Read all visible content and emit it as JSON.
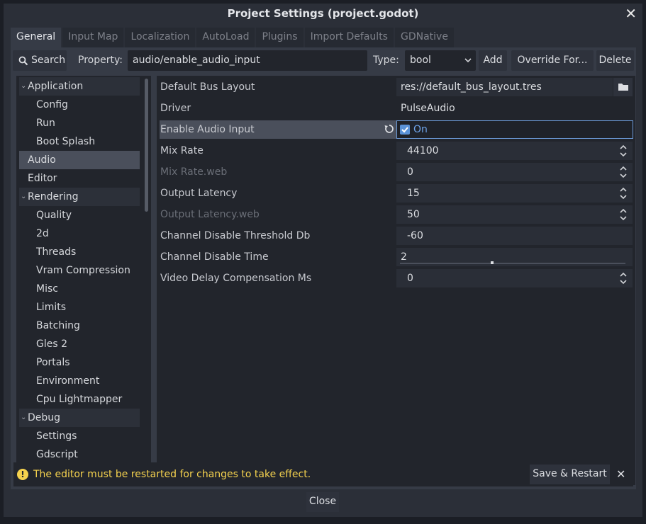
{
  "window": {
    "title": "Project Settings (project.godot)"
  },
  "tabs": [
    {
      "label": "General",
      "active": true
    },
    {
      "label": "Input Map",
      "active": false
    },
    {
      "label": "Localization",
      "active": false
    },
    {
      "label": "AutoLoad",
      "active": false
    },
    {
      "label": "Plugins",
      "active": false
    },
    {
      "label": "Import Defaults",
      "active": false
    },
    {
      "label": "GDNative",
      "active": false
    }
  ],
  "toolbar": {
    "search_label": "Search",
    "property_label": "Property:",
    "property_value": "audio/enable_audio_input",
    "type_label": "Type:",
    "type_value": "bool",
    "add_label": "Add",
    "override_label": "Override For...",
    "delete_label": "Delete"
  },
  "tree": [
    {
      "label": "Application",
      "kind": "section"
    },
    {
      "label": "Config",
      "kind": "child"
    },
    {
      "label": "Run",
      "kind": "child"
    },
    {
      "label": "Boot Splash",
      "kind": "child"
    },
    {
      "label": "Audio",
      "kind": "top",
      "selected": true
    },
    {
      "label": "Editor",
      "kind": "top"
    },
    {
      "label": "Rendering",
      "kind": "section"
    },
    {
      "label": "Quality",
      "kind": "child"
    },
    {
      "label": "2d",
      "kind": "child"
    },
    {
      "label": "Threads",
      "kind": "child"
    },
    {
      "label": "Vram Compression",
      "kind": "child"
    },
    {
      "label": "Misc",
      "kind": "child"
    },
    {
      "label": "Limits",
      "kind": "child"
    },
    {
      "label": "Batching",
      "kind": "child"
    },
    {
      "label": "Gles 2",
      "kind": "child"
    },
    {
      "label": "Portals",
      "kind": "child"
    },
    {
      "label": "Environment",
      "kind": "child"
    },
    {
      "label": "Cpu Lightmapper",
      "kind": "child"
    },
    {
      "label": "Debug",
      "kind": "section"
    },
    {
      "label": "Settings",
      "kind": "child"
    },
    {
      "label": "Gdscript",
      "kind": "child"
    }
  ],
  "properties": {
    "default_bus_layout": {
      "name": "Default Bus Layout",
      "value": "res://default_bus_layout.tres"
    },
    "driver": {
      "name": "Driver",
      "value": "PulseAudio"
    },
    "enable_audio_input": {
      "name": "Enable Audio Input",
      "value": "On",
      "checked": true
    },
    "mix_rate": {
      "name": "Mix Rate",
      "value": "44100"
    },
    "mix_rate_web": {
      "name": "Mix Rate.web",
      "value": "0"
    },
    "output_latency": {
      "name": "Output Latency",
      "value": "15"
    },
    "output_latency_web": {
      "name": "Output Latency.web",
      "value": "50"
    },
    "channel_disable_threshold_db": {
      "name": "Channel Disable Threshold Db",
      "value": "-60"
    },
    "channel_disable_time": {
      "name": "Channel Disable Time",
      "value": "2"
    },
    "video_delay_compensation_ms": {
      "name": "Video Delay Compensation Ms",
      "value": "0"
    }
  },
  "notice": {
    "icon": "warning-icon",
    "message": "The editor must be restarted for changes to take effect.",
    "save_restart_label": "Save & Restart"
  },
  "footer": {
    "close_label": "Close"
  },
  "colors": {
    "accent": "#5b93d8",
    "warning": "#f5d24e",
    "panel": "#363b46"
  }
}
